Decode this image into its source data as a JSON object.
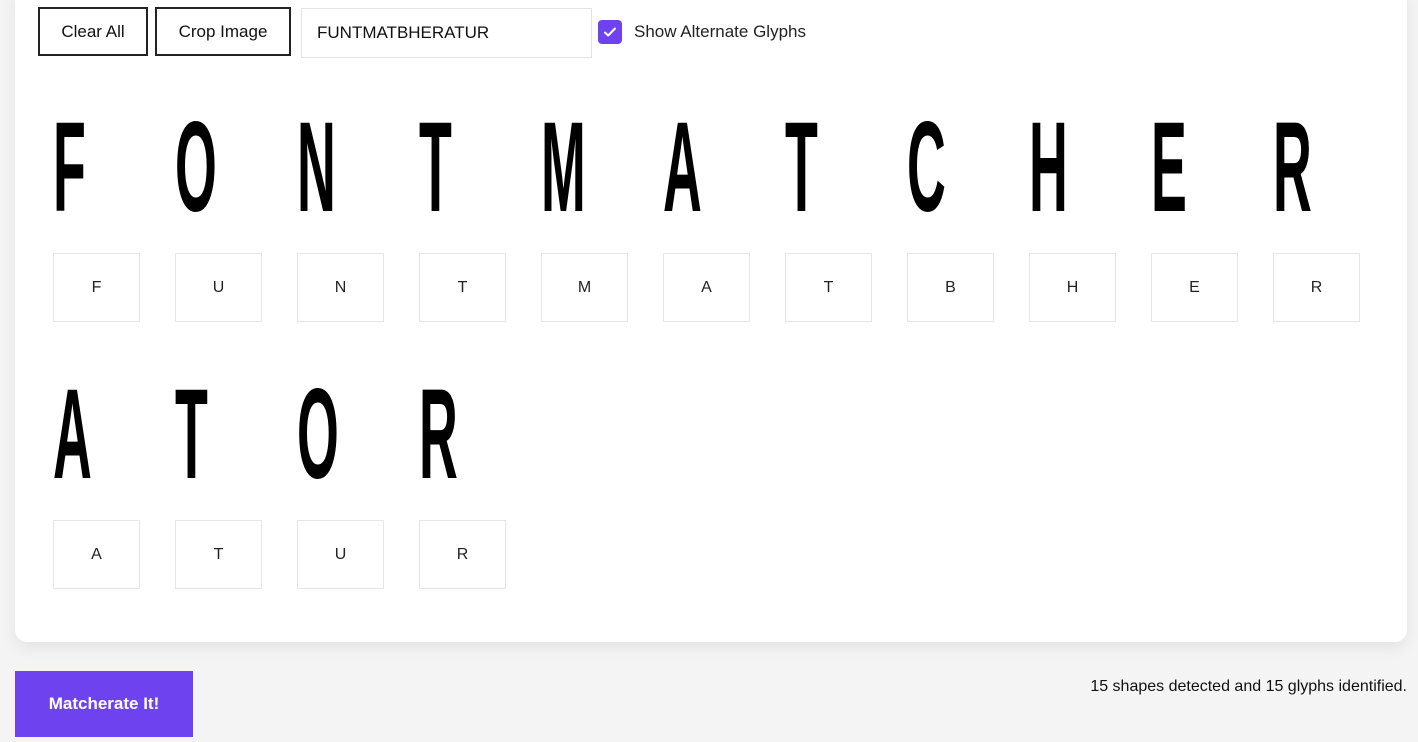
{
  "toolbar": {
    "clear_label": "Clear All",
    "crop_label": "Crop Image",
    "text_value": "FUNTMATBHERATUR",
    "alternate_label": "Show Alternate Glyphs",
    "alternate_checked": true
  },
  "rows": [
    {
      "shapes": [
        "F",
        "O",
        "N",
        "T",
        "M",
        "A",
        "T",
        "C",
        "H",
        "E",
        "R"
      ],
      "glyphs": [
        "F",
        "U",
        "N",
        "T",
        "M",
        "A",
        "T",
        "B",
        "H",
        "E",
        "R"
      ]
    },
    {
      "shapes": [
        "A",
        "T",
        "O",
        "R"
      ],
      "glyphs": [
        "A",
        "T",
        "U",
        "R"
      ]
    }
  ],
  "action": {
    "label": "Matcherate It!"
  },
  "status": "15 shapes detected and 15 glyphs identified.",
  "colors": {
    "accent": "#6f42f0",
    "background": "#f4f4f5"
  }
}
